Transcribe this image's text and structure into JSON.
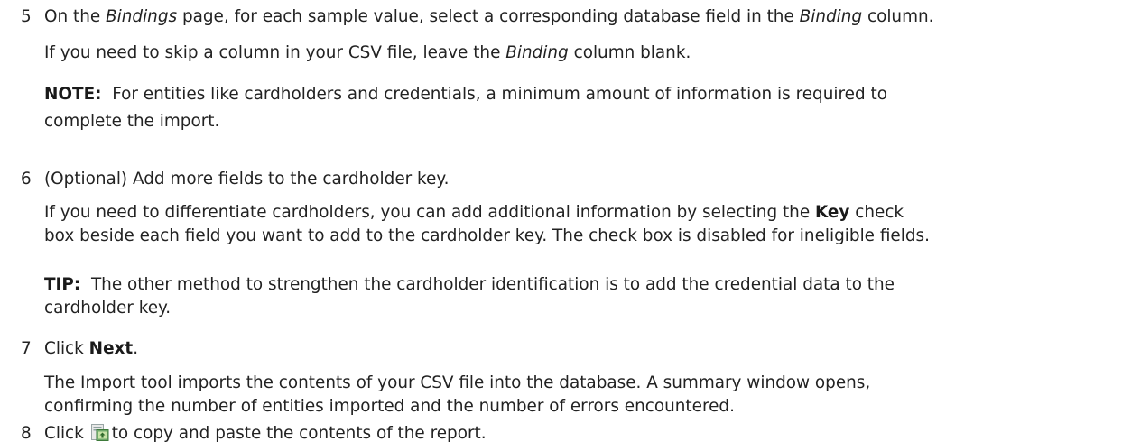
{
  "step5": {
    "number": "5",
    "line1_a": "On the ",
    "line1_page": "Bindings",
    "line1_b": " page, for each sample value, select a corresponding database field in the ",
    "line1_col": "Binding",
    "line1_c": " column.",
    "line2_a": "If you need to skip a column in your CSV file, leave the ",
    "line2_col": "Binding",
    "line2_b": " column blank.",
    "note_label": "NOTE:",
    "note_line1": "For entities like cardholders and credentials, a minimum amount of information is required to",
    "note_line2": "complete the import."
  },
  "step6": {
    "number": "6",
    "title": "(Optional) Add more fields to the cardholder key.",
    "desc_line1_a": "If you need to differentiate cardholders, you can add additional information by selecting the ",
    "desc_key": "Key",
    "desc_line1_b": " check",
    "desc_line2": "box beside each field you want to add to the cardholder key. The check box is disabled for ineligible fields.",
    "tip_label": "TIP:",
    "tip_line1": "The other method to strengthen the cardholder identification is to add the credential data to the",
    "tip_line2": "cardholder key."
  },
  "step7": {
    "number": "7",
    "click": "Click ",
    "button": "Next",
    "period": ".",
    "desc_line1": "The Import tool imports the contents of your CSV file into the database. A summary window opens,",
    "desc_line2": "confirming the number of entities imported and the number of errors encountered."
  },
  "step8": {
    "number": "8",
    "click": "Click",
    "icon": "copy-report-icon",
    "rest": "to copy and paste the contents of the report."
  }
}
